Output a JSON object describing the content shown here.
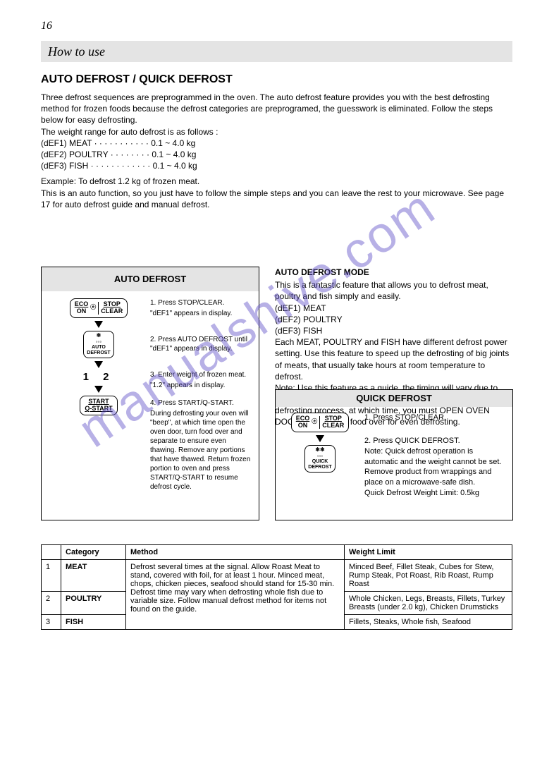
{
  "page_number": "16",
  "header": "How to use",
  "section": "AUTO DEFROST / QUICK DEFROST",
  "intro_lines": [
    "Three defrost sequences are preprogrammed in the oven. The auto defrost feature provides you with the best defrosting method for frozen foods because the defrost categories are preprogramed, the guesswork is eliminated. Follow the steps below for easy defrosting.",
    "The weight range for auto defrost is as follows :",
    "(dEF1) MEAT · · · · · · · · · · · 0.1 ~ 4.0 kg",
    "(dEF2) POULTRY · · · · · · · · 0.1 ~ 4.0 kg",
    "(dEF3) FISH · · · · · · · · · · · · 0.1 ~ 4.0 kg",
    "Example: To defrost 1.2 kg of frozen meat.",
    "This is an auto function, so you just have to follow the simple steps and you can leave the rest to your microwave. See page 17 for auto defrost guide and manual defrost."
  ],
  "panel_left": {
    "title": "AUTO DEFROST",
    "steps": [
      {
        "btn_top": "ECO\nON",
        "btn_right": "STOP\nCLEAR",
        "text": "1. Press STOP/CLEAR.",
        "extra": "\"dEF1\" appears in display."
      },
      {
        "btn": "AUTO\nDEFROST",
        "text": "2. Press AUTO DEFROST until \"dEF1\" appears in display."
      },
      {
        "num": "1  2",
        "text": "3. Enter weight of frozen meat.",
        "extra": "\"1.2\" appears in display."
      },
      {
        "btn": "START\nQ-START",
        "text": "4. Press START/Q-START.",
        "extra": "During defrosting your oven will \"beep\", at which time open the oven door, turn food over and separate to ensure even thawing. Remove any portions that have thawed. Return frozen portion to oven and press START/Q-START to resume defrost cycle."
      }
    ]
  },
  "auto_col": {
    "sub": "AUTO DEFROST MODE",
    "lines": [
      "This is a fantastic feature that allows you to defrost meat, poultry and fish simply and easily.",
      "(dEF1) MEAT",
      "(dEF2) POULTRY",
      "(dEF3) FISH",
      "Each MEAT, POULTRY and FISH have different defrost power setting. Use this feature to speed up the defrosting of big joints of meats, that usually take hours at room temperature to defrost.",
      "Note: Use this feature as a guide, the timing will vary due to how frozen the food is. 2 beep sounds will be heard during the defrosting process, at which time, you must OPEN OVEN DOOR and turn the food over for even defrosting."
    ]
  },
  "panel_right": {
    "title": "QUICK DEFROST",
    "btn_top": "ECO\nON",
    "btn_right": "STOP\nCLEAR",
    "btn2": "QUICK\nDEFROST",
    "lines": [
      "1. Press STOP/CLEAR.",
      "2. Press QUICK DEFROST.",
      "Note: Quick defrost operation is automatic and the weight cannot be set. Remove product from wrappings and place on a microwave-safe dish.",
      "Quick Defrost Weight Limit: 0.5kg"
    ]
  },
  "table": {
    "headers": [
      "",
      "Category",
      "Method",
      "Weight Limit"
    ],
    "rows": [
      {
        "num": "1",
        "category": "MEAT",
        "method": "Defrost several times at the signal. Allow Roast Meat to stand, covered with foil, for at least 1 hour. Minced meat, chops, chicken pieces, seafood should stand for 15-30 min. Defrost time may vary when defrosting whole fish due to variable size. Follow manual defrost method for items not found on the guide.",
        "limit": "Minced Beef, Fillet Steak, Cubes for Stew, Rump Steak, Pot Roast, Rib Roast, Rump Roast"
      },
      {
        "num": "2",
        "category": "POULTRY",
        "method": "",
        "limit": "Whole Chicken, Legs, Breasts, Fillets, Turkey Breasts (under 2.0 kg), Chicken Drumsticks"
      },
      {
        "num": "3",
        "category": "FISH",
        "method": "",
        "limit": "Fillets, Steaks, Whole fish, Seafood"
      }
    ]
  },
  "watermark": "manualshive.com"
}
